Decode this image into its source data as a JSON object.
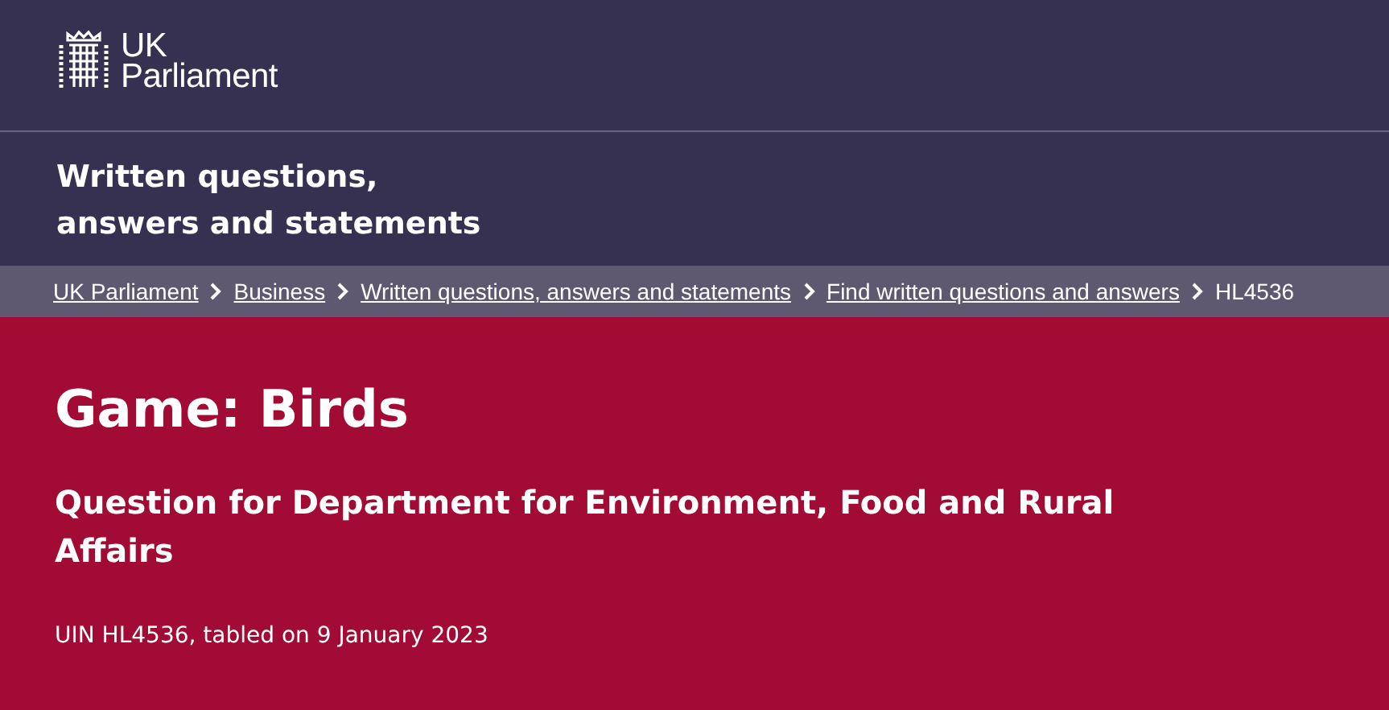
{
  "header": {
    "logo_lines": [
      "UK",
      "Parliament"
    ],
    "section_title": "Written questions, answers and statements"
  },
  "breadcrumb": {
    "links": [
      "UK Parliament",
      "Business",
      "Written questions, answers and statements",
      "Find written questions and answers"
    ],
    "current": "HL4536"
  },
  "question": {
    "title": "Game: Birds",
    "department": "Question for Department for Environment, Food and Rural Affairs",
    "meta": "UIN HL4536, tabled on 9 January 2023"
  }
}
